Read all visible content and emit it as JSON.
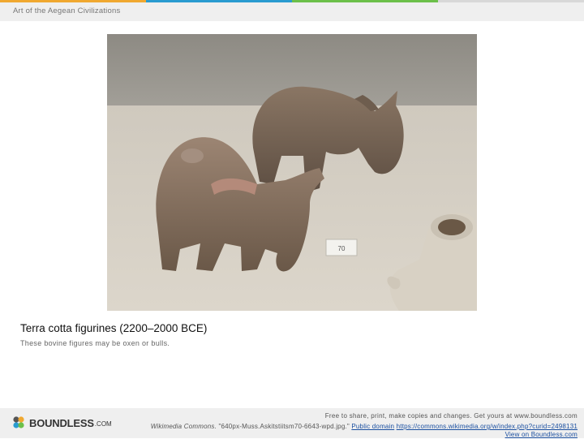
{
  "header": {
    "title": "Art of the Aegean Civilizations"
  },
  "colors": {
    "bar": [
      "#f0a830",
      "#2a9bd0",
      "#6cc04a",
      "#d8d8d8"
    ]
  },
  "image": {
    "subject": "terra-cotta-bovine-figurines-photo"
  },
  "caption": {
    "title": "Terra cotta figurines (2200–2000 BCE)",
    "text": "These bovine figures may be oxen or bulls."
  },
  "tag_label": "70",
  "footer": {
    "logo": "BOUNDLESS",
    "logo_suffix": ".COM",
    "line1": "Free to share, print, make copies and changes. Get yours at www.boundless.com",
    "source_prefix": "Wikimedia Commons.",
    "source_file": " \"640px-Muss.Askitstiitsm70-6643-wpd.jpg.\" ",
    "link_license": "Public domain",
    "link_url": "https://commons.wikimedia.org/w/index.php?curid=2498131",
    "link_view": "View on Boundless.com"
  }
}
